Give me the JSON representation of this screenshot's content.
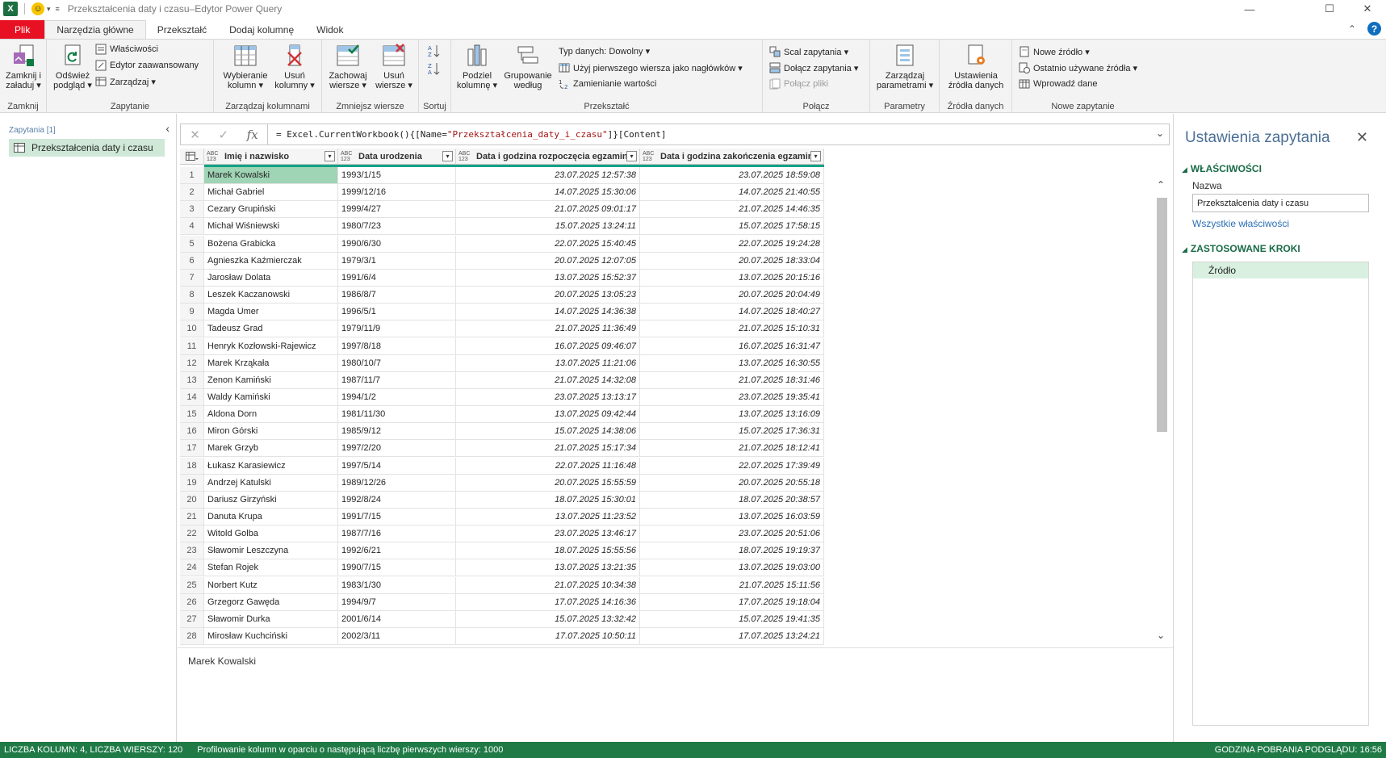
{
  "window": {
    "title": "Przekształcenia daty i czasu–Edytor Power Query",
    "app_icon": "X",
    "min_glyph": "—",
    "max_glyph": "☐",
    "close_glyph": "✕"
  },
  "ribbon_tabs": [
    "Plik",
    "Narzędzia główne",
    "Przekształć",
    "Dodaj kolumnę",
    "Widok"
  ],
  "ribbon": {
    "groups": {
      "zamknij": "Zamknij",
      "zapytanie": "Zapytanie",
      "kolumny": "Zarządzaj kolumnami",
      "wiersze": "Zmniejsz wiersze",
      "sortuj": "Sortuj",
      "przeksztalc": "Przekształć",
      "polacz": "Połącz",
      "parametry": "Parametry",
      "zrodla": "Źródła danych",
      "nowe": "Nowe zapytanie"
    },
    "buttons": {
      "zamknij_l1": "Zamknij i",
      "zamknij_l2": "załaduj ▾",
      "odswiez_l1": "Odśwież",
      "odswiez_l2": "podgląd ▾",
      "wlasciwosci": "Właściwości",
      "edytor": "Edytor zaawansowany",
      "zarzadzaj": "Zarządzaj ▾",
      "wybieranie_l1": "Wybieranie",
      "wybieranie_l2": "kolumn ▾",
      "usun_kol_l1": "Usuń",
      "usun_kol_l2": "kolumny ▾",
      "zachowaj_l1": "Zachowaj",
      "zachowaj_l2": "wiersze ▾",
      "usun_w_l1": "Usuń",
      "usun_w_l2": "wiersze ▾",
      "podziel_l1": "Podziel",
      "podziel_l2": "kolumnę ▾",
      "grupowanie_l1": "Grupowanie",
      "grupowanie_l2": "według",
      "typ_danych": "Typ danych: Dowolny ▾",
      "uzyj_naglowkow": "Użyj pierwszego wiersza jako nagłówków ▾",
      "zamienianie": "Zamienianie wartości",
      "scal": "Scal zapytania ▾",
      "dolacz": "Dołącz zapytania ▾",
      "polacz_pliki": "Połącz pliki",
      "parametry_l1": "Zarządzaj",
      "parametry_l2": "parametrami ▾",
      "ustawienia_l1": "Ustawienia",
      "ustawienia_l2": "źródła danych",
      "nowe_zrodlo": "Nowe źródło ▾",
      "ostatnio": "Ostatnio używane źródła ▾",
      "wprowadz": "Wprowadź dane"
    }
  },
  "queries_panel": {
    "header": "Zapytania [1]",
    "items": [
      "Przekształcenia daty i czasu"
    ]
  },
  "formula_bar": {
    "prefix": "= Excel.CurrentWorkbook(){[Name=",
    "string": "\"Przekształcenia_daty_i_czasu\"",
    "suffix": "]}[Content]",
    "fx": "fx"
  },
  "table": {
    "type_badge": "ABC\n123",
    "columns": [
      "Imię i nazwisko",
      "Data urodzenia",
      "Data i godzina rozpoczęcia egzaminu",
      "Data i godzina zakończenia egzaminu"
    ],
    "rows": [
      [
        "1",
        "Marek Kowalski",
        "1993/1/15",
        "23.07.2025 12:57:38",
        "23.07.2025 18:59:08"
      ],
      [
        "2",
        "Michał Gabriel",
        "1999/12/16",
        "14.07.2025 15:30:06",
        "14.07.2025 21:40:55"
      ],
      [
        "3",
        "Cezary Grupiński",
        "1999/4/27",
        "21.07.2025 09:01:17",
        "21.07.2025 14:46:35"
      ],
      [
        "4",
        "Michał Wiśniewski",
        "1980/7/23",
        "15.07.2025 13:24:11",
        "15.07.2025 17:58:15"
      ],
      [
        "5",
        "Bożena Grabicka",
        "1990/6/30",
        "22.07.2025 15:40:45",
        "22.07.2025 19:24:28"
      ],
      [
        "6",
        "Agnieszka Kaźmierczak",
        "1979/3/1",
        "20.07.2025 12:07:05",
        "20.07.2025 18:33:04"
      ],
      [
        "7",
        "Jarosław Dolata",
        "1991/6/4",
        "13.07.2025 15:52:37",
        "13.07.2025 20:15:16"
      ],
      [
        "8",
        "Leszek Kaczanowski",
        "1986/8/7",
        "20.07.2025 13:05:23",
        "20.07.2025 20:04:49"
      ],
      [
        "9",
        "Magda Umer",
        "1996/5/1",
        "14.07.2025 14:36:38",
        "14.07.2025 18:40:27"
      ],
      [
        "10",
        "Tadeusz Grad",
        "1979/11/9",
        "21.07.2025 11:36:49",
        "21.07.2025 15:10:31"
      ],
      [
        "11",
        "Henryk Kozłowski-Rajewicz",
        "1997/8/18",
        "16.07.2025 09:46:07",
        "16.07.2025 16:31:47"
      ],
      [
        "12",
        "Marek Krząkała",
        "1980/10/7",
        "13.07.2025 11:21:06",
        "13.07.2025 16:30:55"
      ],
      [
        "13",
        "Zenon Kamiński",
        "1987/11/7",
        "21.07.2025 14:32:08",
        "21.07.2025 18:31:46"
      ],
      [
        "14",
        "Waldy Kamiński",
        "1994/1/2",
        "23.07.2025 13:13:17",
        "23.07.2025 19:35:41"
      ],
      [
        "15",
        "Aldona Dorn",
        "1981/11/30",
        "13.07.2025 09:42:44",
        "13.07.2025 13:16:09"
      ],
      [
        "16",
        "Miron Górski",
        "1985/9/12",
        "15.07.2025 14:38:06",
        "15.07.2025 17:36:31"
      ],
      [
        "17",
        "Marek Grzyb",
        "1997/2/20",
        "21.07.2025 15:17:34",
        "21.07.2025 18:12:41"
      ],
      [
        "18",
        "Łukasz Karasiewicz",
        "1997/5/14",
        "22.07.2025 11:16:48",
        "22.07.2025 17:39:49"
      ],
      [
        "19",
        "Andrzej Katulski",
        "1989/12/26",
        "20.07.2025 15:55:59",
        "20.07.2025 20:55:18"
      ],
      [
        "20",
        "Dariusz Girzyński",
        "1992/8/24",
        "18.07.2025 15:30:01",
        "18.07.2025 20:38:57"
      ],
      [
        "21",
        "Danuta Krupa",
        "1991/7/15",
        "13.07.2025 11:23:52",
        "13.07.2025 16:03:59"
      ],
      [
        "22",
        "Witold Golba",
        "1987/7/16",
        "23.07.2025 13:46:17",
        "23.07.2025 20:51:06"
      ],
      [
        "23",
        "Sławomir Leszczyna",
        "1992/6/21",
        "18.07.2025 15:55:56",
        "18.07.2025 19:19:37"
      ],
      [
        "24",
        "Stefan Rojek",
        "1990/7/15",
        "13.07.2025 13:21:35",
        "13.07.2025 19:03:00"
      ],
      [
        "25",
        "Norbert Kutz",
        "1983/1/30",
        "21.07.2025 10:34:38",
        "21.07.2025 15:11:56"
      ],
      [
        "26",
        "Grzegorz Gawęda",
        "1994/9/7",
        "17.07.2025 14:16:36",
        "17.07.2025 19:18:04"
      ],
      [
        "27",
        "Sławomir Durka",
        "2001/6/14",
        "15.07.2025 13:32:42",
        "15.07.2025 19:41:35"
      ],
      [
        "28",
        "Mirosław Kuchciński",
        "2002/3/11",
        "17.07.2025 10:50:11",
        "17.07.2025 13:24:21"
      ]
    ]
  },
  "preview_value": "Marek Kowalski",
  "settings_panel": {
    "title": "Ustawienia zapytania",
    "properties_header": "WŁAŚCIWOŚCI",
    "name_label": "Nazwa",
    "name_value": "Przekształcenia daty i czasu",
    "all_properties": "Wszystkie właściwości",
    "steps_header": "ZASTOSOWANE KROKI",
    "steps": [
      "Źródło"
    ]
  },
  "status": {
    "left": "LICZBA KOLUMN: 4, LICZBA WIERSZY: 120",
    "middle": "Profilowanie kolumn w oparciu o następującą liczbę pierwszych wierszy: 1000",
    "right": "GODZINA POBRANIA PODGLĄDU: 16:56"
  },
  "colors": {
    "file_tab": "#e81123",
    "status_bar": "#1f7a46",
    "selected_cell": "#9fd4b5",
    "quality_bar": "#14a187"
  }
}
